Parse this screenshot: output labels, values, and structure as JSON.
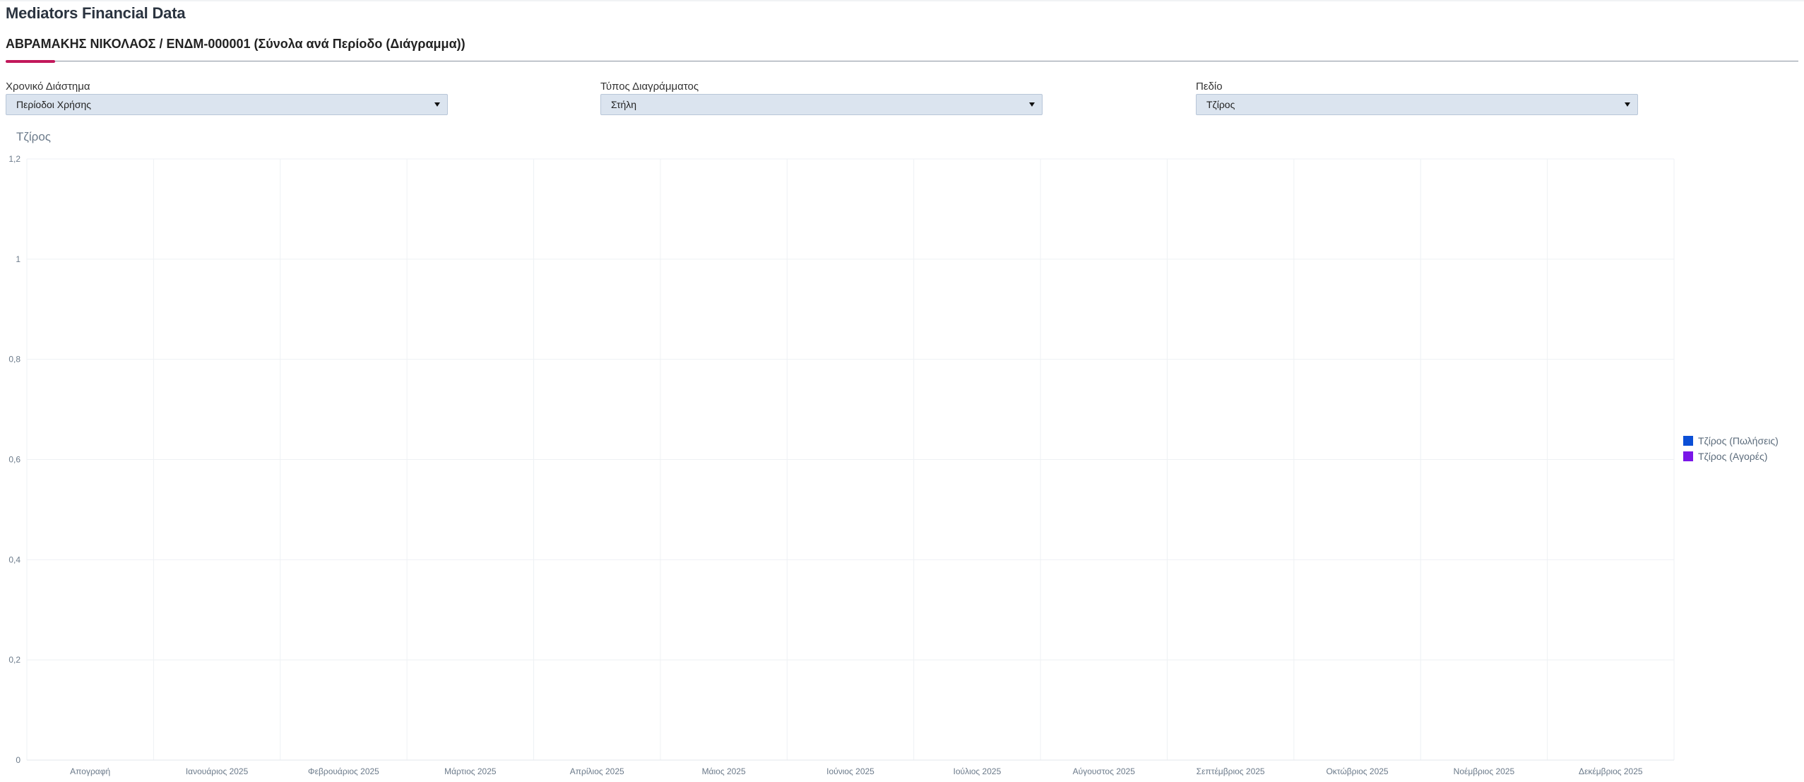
{
  "app": {
    "title": "Mediators Financial Data"
  },
  "tab": {
    "title": "ΑΒΡΑΜΑΚΗΣ ΝΙΚΟΛΑΟΣ / ΕΝΔΜ-000001 (Σύνολα ανά Περίοδο (Διάγραμμα))",
    "accent_color": "#c2185b"
  },
  "filters": {
    "period": {
      "label": "Χρονικό Διάστημα",
      "value": "Περίοδοι Χρήσης"
    },
    "chart_type": {
      "label": "Τύπος Διαγράμματος",
      "value": "Στήλη"
    },
    "field": {
      "label": "Πεδίο",
      "value": "Τζίρος"
    }
  },
  "chart_data": {
    "type": "bar",
    "title": "Τζίρος",
    "xlabel": "",
    "ylabel": "",
    "categories": [
      "Απογραφή",
      "Ιανουάριος 2025",
      "Φεβρουάριος 2025",
      "Μάρτιος 2025",
      "Απρίλιος 2025",
      "Μάιος 2025",
      "Ιούνιος 2025",
      "Ιούλιος 2025",
      "Αύγουστος 2025",
      "Σεπτέμβριος 2025",
      "Οκτώβριος 2025",
      "Νοέμβριος 2025",
      "Δεκέμβριος 2025"
    ],
    "series": [
      {
        "name": "Τζίρος (Πωλήσεις)",
        "color": "#0b4fd6",
        "values": [
          0,
          0,
          0,
          0,
          0,
          0,
          0,
          0,
          0,
          0,
          0,
          0,
          0
        ]
      },
      {
        "name": "Τζίρος (Αγορές)",
        "color": "#7a16e8",
        "values": [
          0,
          0,
          0,
          0,
          0,
          0,
          0,
          0,
          0,
          0,
          0,
          0,
          0
        ]
      }
    ],
    "ylim": [
      0,
      1.2
    ],
    "yticks": [
      0,
      0.2,
      0.4,
      0.6,
      0.8,
      1,
      1.2
    ],
    "ytick_labels": [
      "0",
      "0,2",
      "0,4",
      "0,6",
      "0,8",
      "1",
      "1,2"
    ],
    "grid": true,
    "legend_position": "right"
  }
}
